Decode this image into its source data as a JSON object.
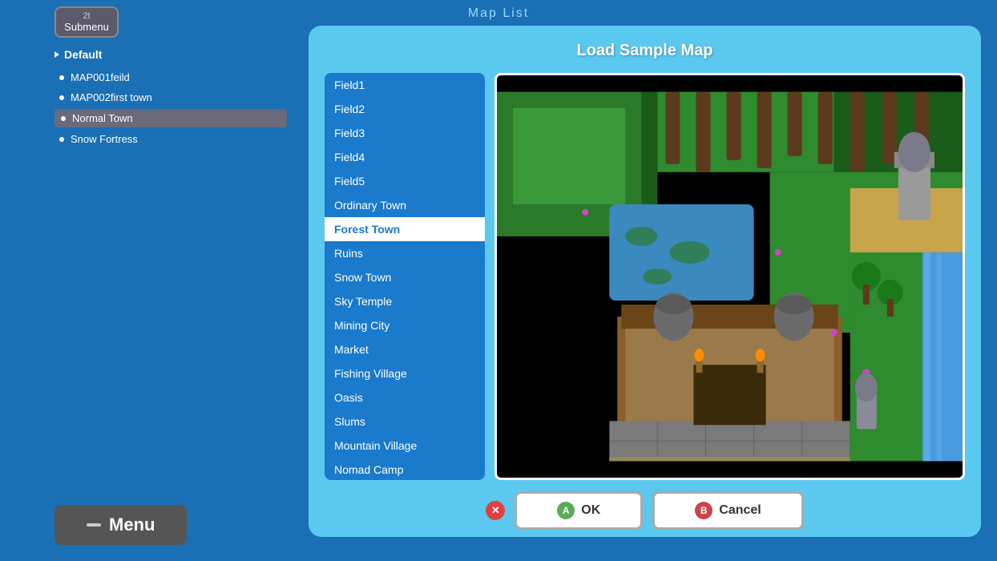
{
  "topHint": "Map List",
  "submenu": {
    "icon": "2t",
    "label": "Submenu"
  },
  "sidebar": {
    "groupLabel": "Default",
    "items": [
      {
        "id": "map001",
        "label": "MAP001feild",
        "active": false
      },
      {
        "id": "map002",
        "label": "MAP002first town",
        "active": false
      },
      {
        "id": "normaltown",
        "label": "Normal Town",
        "active": true
      },
      {
        "id": "snowfortress",
        "label": "Snow Fortress",
        "active": false
      }
    ]
  },
  "menu": {
    "label": "Menu"
  },
  "dialog": {
    "title": "Load Sample Map",
    "mapList": [
      {
        "id": "field1",
        "label": "Field1"
      },
      {
        "id": "field2",
        "label": "Field2"
      },
      {
        "id": "field3",
        "label": "Field3"
      },
      {
        "id": "field4",
        "label": "Field4"
      },
      {
        "id": "field5",
        "label": "Field5"
      },
      {
        "id": "ordinarytown",
        "label": "Ordinary Town"
      },
      {
        "id": "foresttown",
        "label": "Forest Town",
        "selected": true
      },
      {
        "id": "ruins",
        "label": "Ruins"
      },
      {
        "id": "snowtown",
        "label": "Snow Town"
      },
      {
        "id": "skytemple",
        "label": "Sky Temple"
      },
      {
        "id": "miningcity",
        "label": "Mining City"
      },
      {
        "id": "market",
        "label": "Market"
      },
      {
        "id": "fishingvillage",
        "label": "Fishing Village"
      },
      {
        "id": "oasis",
        "label": "Oasis"
      },
      {
        "id": "slums",
        "label": "Slums"
      },
      {
        "id": "mountainvillage",
        "label": "Mountain Village"
      },
      {
        "id": "nomadcamp",
        "label": "Nomad Camp"
      }
    ],
    "buttons": {
      "ok": "OK",
      "cancel": "Cancel",
      "okBadge": "A",
      "cancelBadge": "B"
    }
  }
}
